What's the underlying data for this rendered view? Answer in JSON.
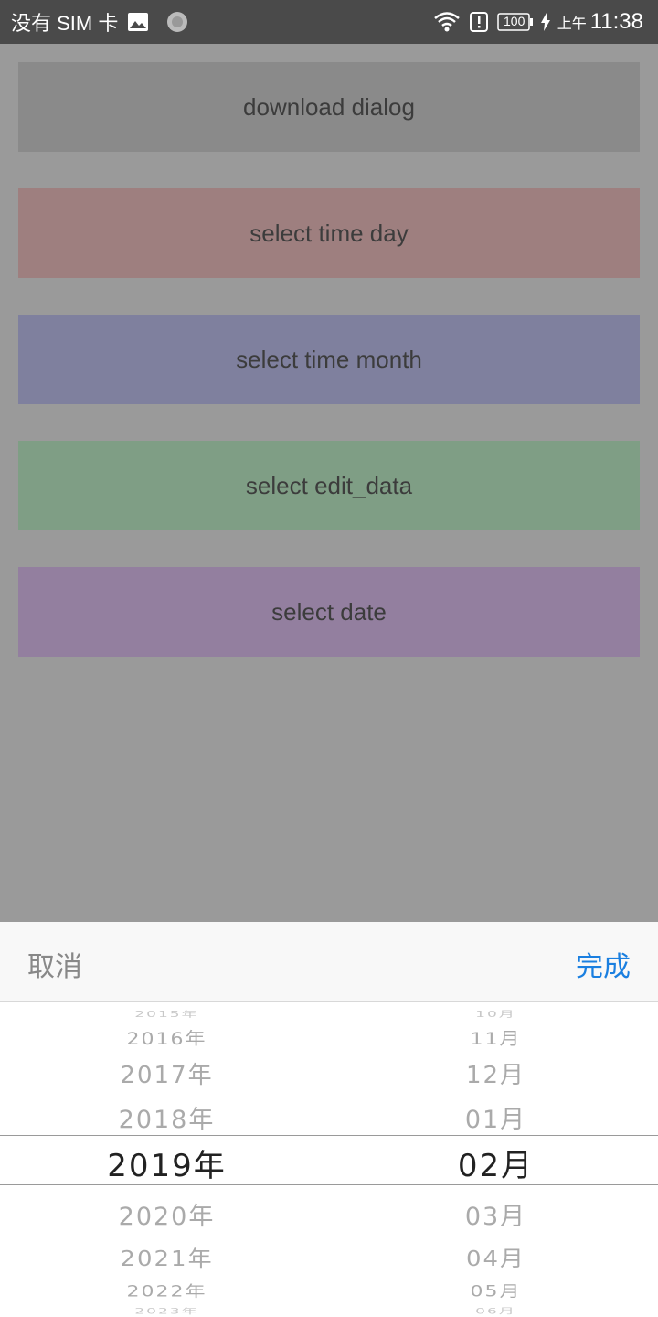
{
  "status_bar": {
    "carrier": "没有 SIM 卡",
    "battery": "100",
    "time_prefix": "上午",
    "time": "11:38",
    "icons": [
      "image-icon",
      "loading-icon",
      "wifi-icon",
      "alert-icon",
      "battery-icon",
      "charging-icon"
    ]
  },
  "buttons": [
    {
      "label": "download dialog",
      "color": "#8a8a8a"
    },
    {
      "label": "select time day",
      "color": "#9e7f7f"
    },
    {
      "label": "select time month",
      "color": "#7f809e"
    },
    {
      "label": "select edit_data",
      "color": "#7f9e85"
    },
    {
      "label": "select date",
      "color": "#937f9f"
    }
  ],
  "picker": {
    "cancel_label": "取消",
    "done_label": "完成",
    "accent_color": "#1a7fe0",
    "years": [
      "2015年",
      "2016年",
      "2017年",
      "2018年",
      "2019年",
      "2020年",
      "2021年",
      "2022年",
      "2023年"
    ],
    "months": [
      "10月",
      "11月",
      "12月",
      "01月",
      "02月",
      "03月",
      "04月",
      "05月",
      "06月"
    ],
    "selected_year": "2019年",
    "selected_month": "02月"
  }
}
